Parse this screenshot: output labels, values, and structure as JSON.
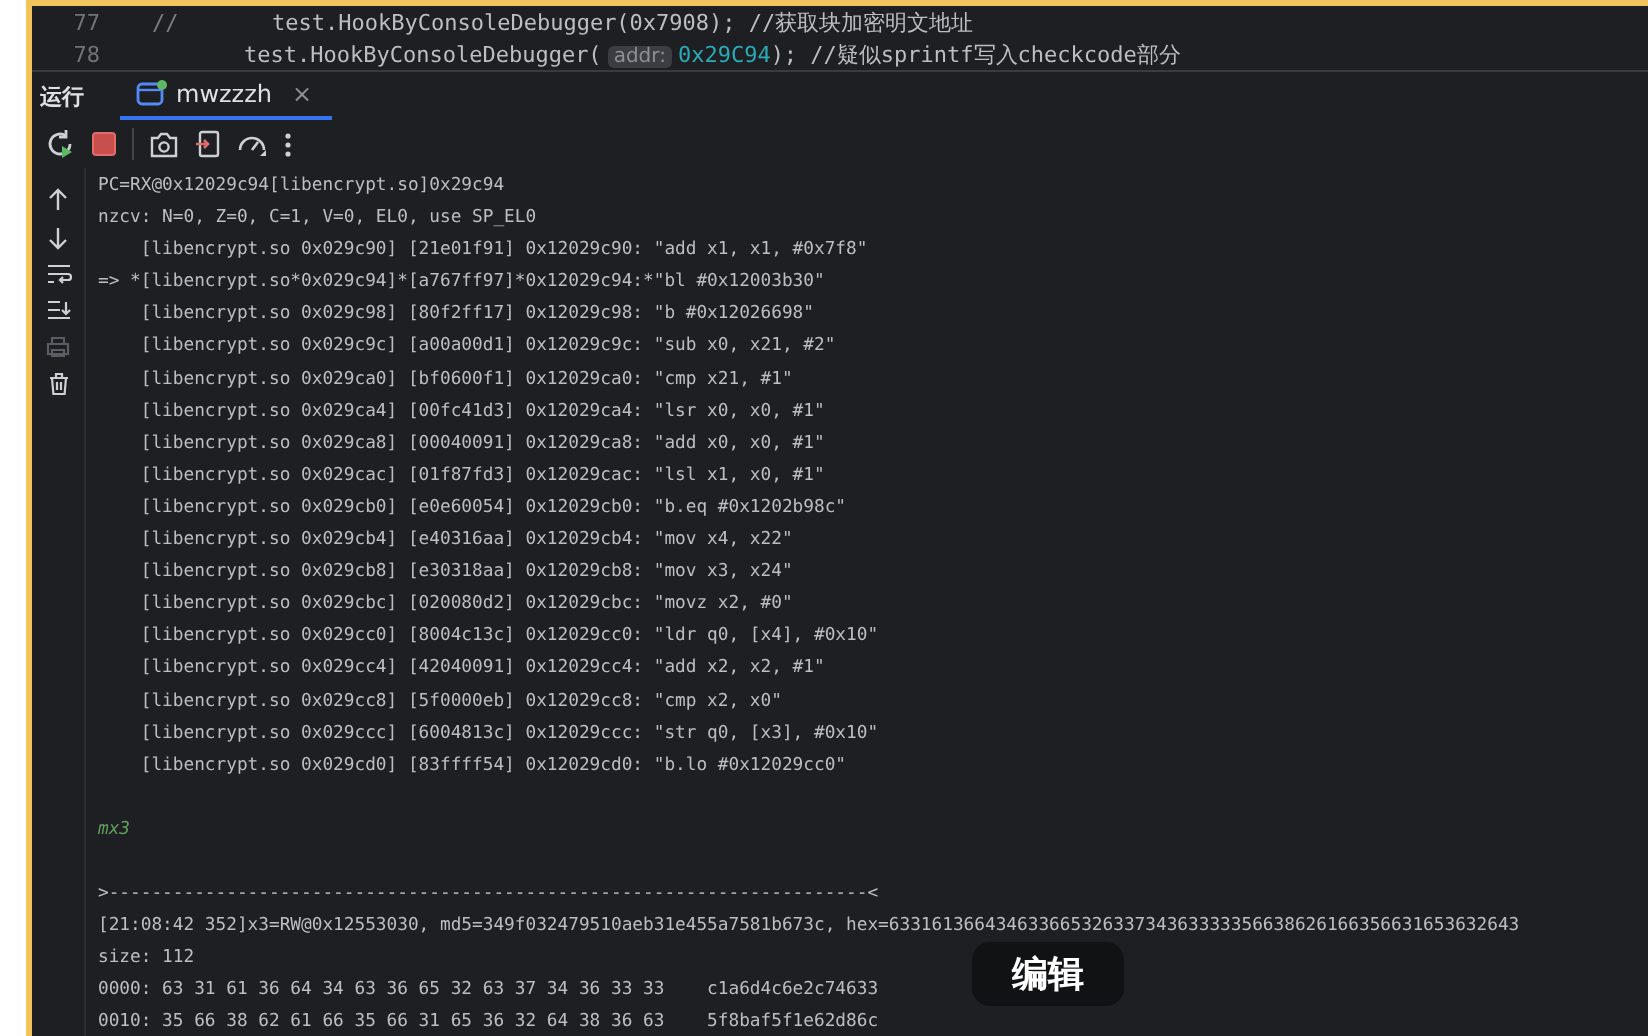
{
  "editor": {
    "lines": [
      {
        "number": "77",
        "marker": "//",
        "code": "test.HookByConsoleDebugger(0x7908); //获取块加密明文地址"
      },
      {
        "number": "78",
        "code_before": "test.HookByConsoleDebugger(",
        "hint": "addr:",
        "arg": "0x29C94",
        "code_after": "); //疑似sprintf写入checkcode部分"
      }
    ]
  },
  "tool_window": {
    "title": "运行",
    "tabs": [
      {
        "label": "mwzzzh",
        "close": "×",
        "selected": true
      }
    ]
  },
  "console": {
    "blocks": [
      {
        "lines": [
          {
            "kind": "output",
            "text": "PC=RX@0x12029c94[libencrypt.so]0x29c94"
          },
          {
            "kind": "output",
            "text": "nzcv: N=0, Z=0, C=1, V=0, EL0, use SP_EL0"
          },
          {
            "kind": "output",
            "text": "    [libencrypt.so 0x029c90] [21e01f91] 0x12029c90: \"add x1, x1, #0x7f8\""
          },
          {
            "kind": "output",
            "text": "=> *[libencrypt.so*0x029c94]*[a767ff97]*0x12029c94:*\"bl #0x12003b30\""
          },
          {
            "kind": "output",
            "text": "    [libencrypt.so 0x029c98] [80f2ff17] 0x12029c98: \"b #0x12026698\""
          },
          {
            "kind": "output",
            "text": "    [libencrypt.so 0x029c9c] [a00a00d1] 0x12029c9c: \"sub x0, x21, #2\""
          },
          {
            "kind": "output",
            "text": "    [libencrypt.so 0x029ca0] [bf0600f1] 0x12029ca0: \"cmp x21, #1\""
          },
          {
            "kind": "output",
            "text": "    [libencrypt.so 0x029ca4] [00fc41d3] 0x12029ca4: \"lsr x0, x0, #1\""
          },
          {
            "kind": "output",
            "text": "    [libencrypt.so 0x029ca8] [00040091] 0x12029ca8: \"add x0, x0, #1\""
          },
          {
            "kind": "output",
            "text": "    [libencrypt.so 0x029cac] [01f87fd3] 0x12029cac: \"lsl x1, x0, #1\""
          },
          {
            "kind": "output",
            "text": "    [libencrypt.so 0x029cb0] [e0e60054] 0x12029cb0: \"b.eq #0x1202b98c\""
          },
          {
            "kind": "output",
            "text": "    [libencrypt.so 0x029cb4] [e40316aa] 0x12029cb4: \"mov x4, x22\""
          },
          {
            "kind": "output",
            "text": "    [libencrypt.so 0x029cb8] [e30318aa] 0x12029cb8: \"mov x3, x24\""
          },
          {
            "kind": "output",
            "text": "    [libencrypt.so 0x029cbc] [020080d2] 0x12029cbc: \"movz x2, #0\""
          },
          {
            "kind": "output",
            "text": "    [libencrypt.so 0x029cc0] [8004c13c] 0x12029cc0: \"ldr q0, [x4], #0x10\""
          },
          {
            "kind": "output",
            "text": "    [libencrypt.so 0x029cc4] [42040091] 0x12029cc4: \"add x2, x2, #1\""
          },
          {
            "kind": "output",
            "text": "    [libencrypt.so 0x029cc8] [5f0000eb] 0x12029cc8: \"cmp x2, x0\""
          },
          {
            "kind": "output",
            "text": "    [libencrypt.so 0x029ccc] [6004813c] 0x12029ccc: \"str q0, [x3], #0x10\""
          },
          {
            "kind": "output",
            "text": "    [libencrypt.so 0x029cd0] [83ffff54] 0x12029cd0: \"b.lo #0x12029cc0\""
          }
        ]
      },
      {
        "lines": [
          {
            "kind": "input",
            "text": "mx3"
          }
        ]
      },
      {
        "lines": [
          {
            "kind": "output",
            "text": ">-----------------------------------------------------------------------<"
          },
          {
            "kind": "output",
            "text": "[21:08:42 352]x3=RW@0x12553030, md5=349f032479510aeb31e455a7581b673c, hex=63316136643463366532633734363333356638626166356631653632643"
          },
          {
            "kind": "output",
            "text": "size: 112"
          },
          {
            "kind": "output",
            "text": "0000: 63 31 61 36 64 34 63 36 65 32 63 37 34 36 33 33    c1a6d4c6e2c74633"
          },
          {
            "kind": "output",
            "text": "0010: 35 66 38 62 61 66 35 66 31 65 36 32 64 38 36 63    5f8baf5f1e62d86c"
          }
        ]
      }
    ]
  },
  "overlay": {
    "label": "编辑"
  }
}
